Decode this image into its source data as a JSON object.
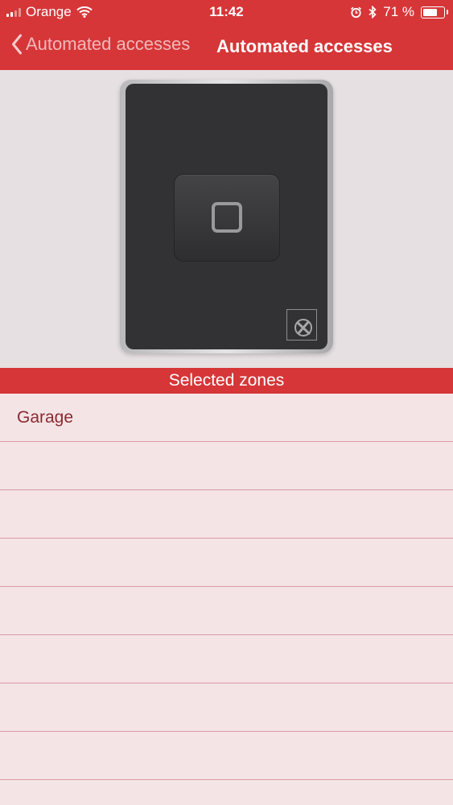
{
  "status_bar": {
    "carrier": "Orange",
    "time": "11:42",
    "battery_percent": "71 %",
    "battery_level": 0.71
  },
  "nav": {
    "back_label": "Automated accesses",
    "title": "Automated accesses"
  },
  "section": {
    "header": "Selected zones"
  },
  "zones": [
    {
      "label": "Garage"
    },
    {
      "label": ""
    },
    {
      "label": ""
    },
    {
      "label": ""
    },
    {
      "label": ""
    },
    {
      "label": ""
    },
    {
      "label": ""
    },
    {
      "label": ""
    }
  ],
  "colors": {
    "accent": "#d63638",
    "list_background": "#f4e4e6",
    "row_text": "#8c2a30",
    "device_body": "#323234"
  },
  "icons": {
    "back": "chevron-left-icon",
    "wifi": "wifi-icon",
    "alarm": "alarm-icon",
    "bluetooth": "bluetooth-icon",
    "battery": "battery-icon",
    "device_logo": "brand-logo-icon"
  }
}
